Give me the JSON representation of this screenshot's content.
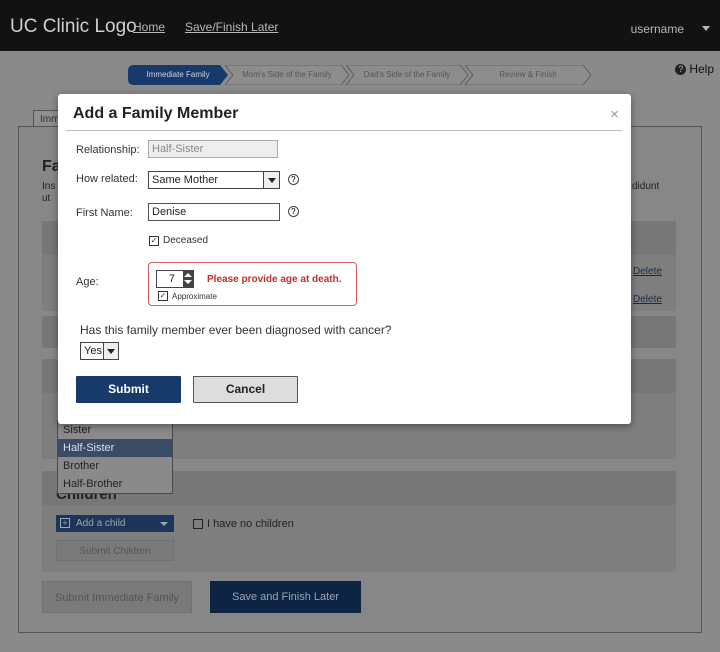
{
  "header": {
    "logo": "UC Clinic Logo",
    "nav": [
      "Home",
      "Save/Finish Later"
    ],
    "username": "username"
  },
  "steps": [
    "Immediate Family",
    "Mom's Side of the Family",
    "Dad's Side of the Family",
    "Review & Finish"
  ],
  "help": "Help",
  "background": {
    "tab_label": "Imm",
    "section_letter": "Fa",
    "ins_text": "Ins",
    "ut_text": "ut",
    "didunt_text": "didunt",
    "delete_labels": [
      "Delete",
      "Delete"
    ],
    "sibling_options": [
      "Sister",
      "Half-Sister",
      "Brother",
      "Half-Brother"
    ],
    "sibling_selected": "Half-Sister",
    "children_title": "Children",
    "add_child": "Add a child",
    "no_children": "I have no children",
    "submit_children": "Submit Children",
    "submit_immediate": "Submit Immediate Family",
    "save_later": "Save and Finish Later"
  },
  "modal": {
    "title": "Add a Family Member",
    "close": "×",
    "relationship_label": "Relationship:",
    "relationship_value": "Half-Sister",
    "how_related_label": "How related:",
    "how_related_value": "Same Mother",
    "first_name_label": "First Name:",
    "first_name_value": "Denise",
    "deceased_label": "Deceased",
    "deceased_checked": true,
    "age_label": "Age:",
    "age_value": "7",
    "age_error": "Please provide age at death.",
    "approximate_label": "Approximate",
    "approximate_checked": true,
    "cancer_question": "Has this family member ever been diagnosed with cancer?",
    "cancer_value": "Yes",
    "submit": "Submit",
    "cancel": "Cancel"
  },
  "colors": {
    "topbar": "#121212",
    "overlay": "#8a8a8a",
    "primary": "#173a6b",
    "error": "#c0302a"
  }
}
